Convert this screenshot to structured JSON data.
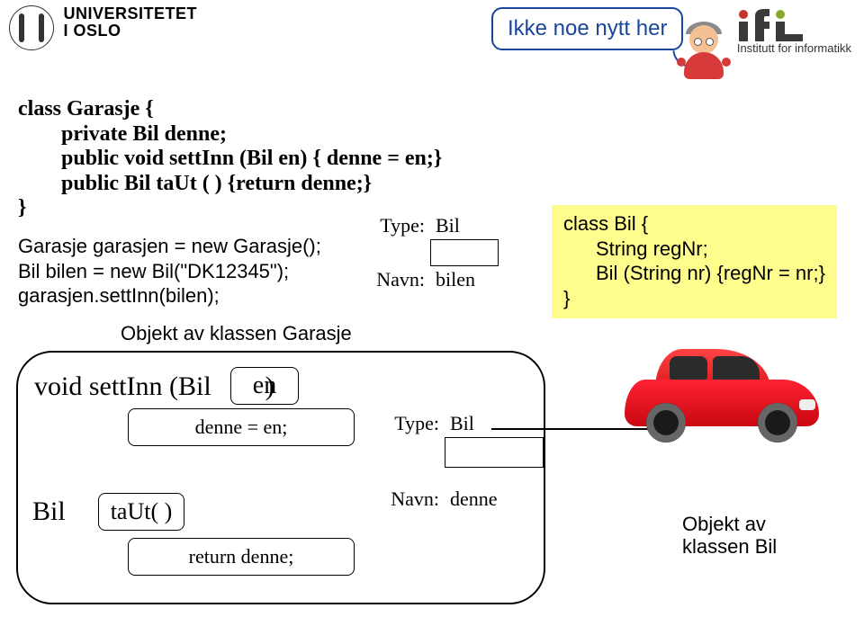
{
  "header": {
    "uio_line1": "UNIVERSITETET",
    "uio_line2": "I OSLO",
    "ifi_mark": "ifi",
    "ifi_sub": "Institutt for informatikk"
  },
  "bubble": {
    "text": "Ikke noe nytt her"
  },
  "code_main": "class Garasje {\n        private Bil denne;\n        public void settInn (Bil en) { denne = en;}\n        public Bil taUt ( ) {return denne;}\n}",
  "code_setup": "Garasje garasjen = new Garasje();\nBil bilen = new Bil(\"DK12345\");\ngarasjen.settInn(bilen);",
  "var_bilen": {
    "type_label": "Type:",
    "type_value": "Bil",
    "name_label": "Navn:",
    "name_value": "bilen"
  },
  "class_bil": {
    "l1": "class Bil {",
    "l2": "String regNr;",
    "l3": "Bil (String nr) {regNr = nr;}",
    "l4": "}"
  },
  "garasje_caption": "Objekt av klassen Garasje",
  "method1": {
    "part1": "void settInn (Bil",
    "param": "en",
    "part2": ")",
    "body": "denne = en;"
  },
  "method2": {
    "type": "Bil",
    "name": "taUt( )",
    "body": "return denne;"
  },
  "var_denne": {
    "type_label": "Type:",
    "type_value": "Bil",
    "name_label": "Navn:",
    "name_value": "denne"
  },
  "car_caption": {
    "l1": "Objekt av",
    "l2": "klassen Bil"
  }
}
